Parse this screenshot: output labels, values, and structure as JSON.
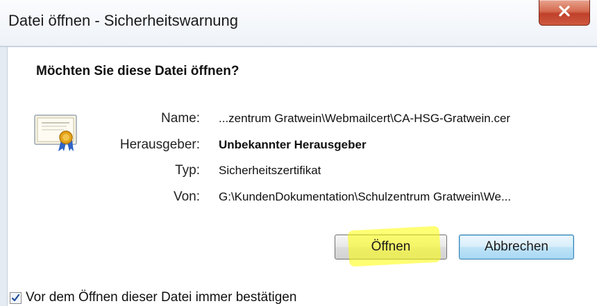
{
  "window": {
    "title": "Datei öffnen - Sicherheitswarnung",
    "close_glyph": "X"
  },
  "dialog": {
    "question": "Möchten Sie diese Datei öffnen?",
    "icon": "certificate-icon",
    "fields": [
      {
        "label": "Name:",
        "value": "...zentrum Gratwein\\Webmailcert\\CA-HSG-Gratwein.cer"
      },
      {
        "label": "Herausgeber:",
        "value": "Unbekannter Herausgeber"
      },
      {
        "label": "Typ:",
        "value": "Sicherheitszertifikat"
      },
      {
        "label": "Von:",
        "value": "G:\\KundenDokumentation\\Schulzentrum Gratwein\\We..."
      }
    ],
    "buttons": {
      "open_label": "Öffnen",
      "cancel_label": "Abbrechen"
    },
    "checkbox": {
      "label": "Vor dem Öffnen dieser Datei immer bestätigen",
      "checked": true
    }
  },
  "colors": {
    "highlight": "#ffff00",
    "close_button": "#c7432d"
  }
}
